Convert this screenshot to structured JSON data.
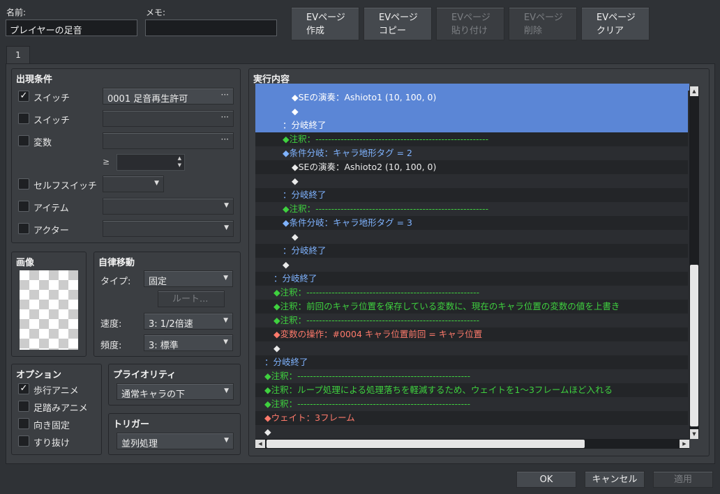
{
  "header": {
    "name_label": "名前:",
    "name_value": "プレイヤーの足音",
    "memo_label": "メモ:",
    "memo_value": ""
  },
  "toolbar": [
    {
      "line1": "EVページ",
      "line2": "作成",
      "enabled": true
    },
    {
      "line1": "EVページ",
      "line2": "コピー",
      "enabled": true
    },
    {
      "line1": "EVページ",
      "line2": "貼り付け",
      "enabled": false
    },
    {
      "line1": "EVページ",
      "line2": "削除",
      "enabled": false
    },
    {
      "line1": "EVページ",
      "line2": "クリア",
      "enabled": true
    }
  ],
  "tab": "1",
  "conditions": {
    "title": "出現条件",
    "items": [
      {
        "label": "スイッチ",
        "checked": true,
        "value": "0001 足音再生許可"
      },
      {
        "label": "スイッチ",
        "checked": false,
        "value": ""
      },
      {
        "label": "変数",
        "checked": false,
        "value": ""
      },
      {
        "label": "セルフスイッチ",
        "checked": false,
        "value": ""
      },
      {
        "label": "アイテム",
        "checked": false,
        "value": ""
      },
      {
        "label": "アクター",
        "checked": false,
        "value": ""
      }
    ],
    "ge": "≥"
  },
  "image": {
    "title": "画像"
  },
  "move": {
    "title": "自律移動",
    "type_label": "タイプ:",
    "type_value": "固定",
    "route_button": "ルート...",
    "speed_label": "速度:",
    "speed_value": "3: 1/2倍速",
    "freq_label": "頻度:",
    "freq_value": "3: 標準"
  },
  "options": {
    "title": "オプション",
    "items": [
      {
        "label": "歩行アニメ",
        "checked": true
      },
      {
        "label": "足踏みアニメ",
        "checked": false
      },
      {
        "label": "向き固定",
        "checked": false
      },
      {
        "label": "すり抜け",
        "checked": false
      }
    ]
  },
  "priority": {
    "title": "プライオリティ",
    "value": "通常キャラの下"
  },
  "trigger": {
    "title": "トリガー",
    "value": "並列処理"
  },
  "contents": {
    "title": "実行内容",
    "lines": [
      {
        "text": "◆SEの演奏：Ashioto1 (10, 100, 0)",
        "indent": 4,
        "color": "w",
        "sel": true
      },
      {
        "text": "◆",
        "indent": 4,
        "color": "w",
        "sel": true
      },
      {
        "text": "：分岐終了",
        "indent": 3,
        "color": "w",
        "sel": true
      },
      {
        "text": "◆注釈：-------------------------------------------------------",
        "indent": 3,
        "color": "g"
      },
      {
        "text": "◆条件分岐：キャラ地形タグ = 2",
        "indent": 3,
        "color": "b"
      },
      {
        "text": "◆SEの演奏：Ashioto2 (10, 100, 0)",
        "indent": 4,
        "color": "w"
      },
      {
        "text": "◆",
        "indent": 4,
        "color": "w"
      },
      {
        "text": "：分岐終了",
        "indent": 3,
        "color": "b"
      },
      {
        "text": "◆注釈：-------------------------------------------------------",
        "indent": 3,
        "color": "g"
      },
      {
        "text": "◆条件分岐：キャラ地形タグ = 3",
        "indent": 3,
        "color": "b"
      },
      {
        "text": "◆",
        "indent": 4,
        "color": "w"
      },
      {
        "text": "：分岐終了",
        "indent": 3,
        "color": "b"
      },
      {
        "text": "◆",
        "indent": 3,
        "color": "w"
      },
      {
        "text": "：分岐終了",
        "indent": 2,
        "color": "b"
      },
      {
        "text": "◆注釈：-------------------------------------------------------",
        "indent": 2,
        "color": "g"
      },
      {
        "text": "◆注釈：前回のキャラ位置を保存している変数に、現在のキャラ位置の変数の値を上書き",
        "indent": 2,
        "color": "g"
      },
      {
        "text": "◆注釈：-------------------------------------------------------",
        "indent": 2,
        "color": "g"
      },
      {
        "text": "◆変数の操作：#0004 キャラ位置前回 = キャラ位置",
        "indent": 2,
        "color": "r"
      },
      {
        "text": "◆",
        "indent": 2,
        "color": "w"
      },
      {
        "text": "：分岐終了",
        "indent": 1,
        "color": "b"
      },
      {
        "text": "◆注釈：-------------------------------------------------------",
        "indent": 1,
        "color": "g"
      },
      {
        "text": "◆注釈：ループ処理による処理落ちを軽減するため、ウェイトを1～3フレームほど入れる",
        "indent": 1,
        "color": "g"
      },
      {
        "text": "◆注釈：-------------------------------------------------------",
        "indent": 1,
        "color": "g"
      },
      {
        "text": "◆ウェイト：3フレーム",
        "indent": 1,
        "color": "r"
      },
      {
        "text": "◆",
        "indent": 1,
        "color": "w"
      }
    ]
  },
  "footer": {
    "ok": "OK",
    "cancel": "キャンセル",
    "apply": "適用"
  }
}
